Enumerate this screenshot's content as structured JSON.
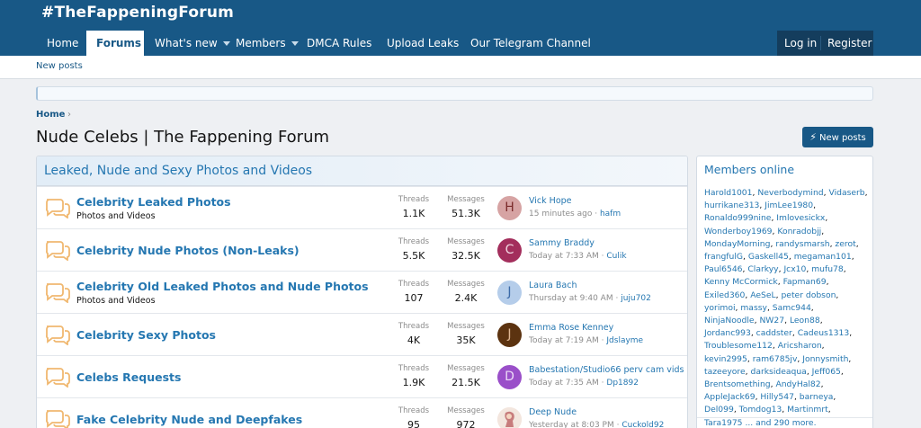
{
  "site": {
    "logo": "#TheFappeningForum"
  },
  "nav": {
    "tabs": [
      {
        "label": "Home"
      },
      {
        "label": "Forums"
      },
      {
        "label": "What's new"
      },
      {
        "label": "Members"
      },
      {
        "label": "DMCA Rules"
      },
      {
        "label": "Upload Leaks"
      },
      {
        "label": "Our Telegram Channel"
      }
    ],
    "login": "Log in",
    "register": "Register"
  },
  "subnav": {
    "new_posts": "New posts"
  },
  "breadcrumb": {
    "home": "Home"
  },
  "page": {
    "title": "Nude Celebs | The Fappening Forum",
    "new_posts_button": "New posts"
  },
  "colors": {
    "header": "#185886",
    "link": "#2577b1",
    "background": "#eef0f3"
  },
  "forum_block": {
    "title": "Leaked, Nude and Sexy Photos and Videos",
    "threads_label": "Threads",
    "messages_label": "Messages",
    "nodes": [
      {
        "title": "Celebrity Leaked Photos",
        "description": "Photos and Videos",
        "threads": "1.1K",
        "messages": "51.3K",
        "avatar_letter": "H",
        "avatar_color": "#d6a3a3",
        "avatar_text_color": "#7a2a2a",
        "last_title": "Vick Hope",
        "last_time": "15 minutes ago",
        "last_user": "hafm"
      },
      {
        "title": "Celebrity Nude Photos (Non-Leaks)",
        "description": "",
        "threads": "5.5K",
        "messages": "32.5K",
        "avatar_letter": "C",
        "avatar_color": "#a32e5c",
        "avatar_text_color": "#f0d6e1",
        "last_title": "Sammy Braddy",
        "last_time": "Today at 7:33 AM",
        "last_user": "Culik"
      },
      {
        "title": "Celebrity Old Leaked Photos and Nude Photos",
        "description": "Photos and Videos",
        "threads": "107",
        "messages": "2.4K",
        "avatar_letter": "J",
        "avatar_color": "#b5cdea",
        "avatar_text_color": "#3b6aa8",
        "last_title": "Laura Bach",
        "last_time": "Thursday at 9:40 AM",
        "last_user": "juju702"
      },
      {
        "title": "Celebrity Sexy Photos",
        "description": "",
        "threads": "4K",
        "messages": "35K",
        "avatar_letter": "J",
        "avatar_color": "#5c3310",
        "avatar_text_color": "#e0b894",
        "last_title": "Emma Rose Kenney",
        "last_time": "Today at 7:19 AM",
        "last_user": "Jdslayme"
      },
      {
        "title": "Celebs Requests",
        "description": "",
        "threads": "1.9K",
        "messages": "21.5K",
        "avatar_letter": "D",
        "avatar_color": "#9a4fc9",
        "avatar_text_color": "#ecdaf7",
        "last_title": "Babestation/Studio66 perv cam vids",
        "last_time": "Today at 7:35 AM",
        "last_user": "Dp1892"
      },
      {
        "title": "Fake Celebrity Nude and Deepfakes",
        "description": "",
        "threads": "95",
        "messages": "972",
        "avatar_letter": "",
        "avatar_color": "#f1e4dc",
        "avatar_text_color": "#b05050",
        "last_title": "Deep Nude",
        "last_time": "Yesterday at 8:03 PM",
        "last_user": "Cuckold92"
      }
    ]
  },
  "members_online": {
    "title": "Members online",
    "members": [
      "Harold1001",
      "Neverbodymind",
      "Vidaserb",
      "hurrikane313",
      "JimLee1980",
      "Ronaldo999nine",
      "Imlovesickx",
      "Wonderboy1969",
      "Konradobjj",
      "MondayMorning",
      "randysmarsh",
      "zerot",
      "frangfulG",
      "Gaskell45",
      "megaman101",
      "Paul6546",
      "Clarkyy",
      "Jcx10",
      "mufu78",
      "Kenny McCormick",
      "Fapman69",
      "Exiled360",
      "AeSeL",
      "peter dobson",
      "yorimoi",
      "massy",
      "Samc944",
      "NinjaNoodle",
      "NW27",
      "Leon88",
      "Jordanc993",
      "caddster",
      "Cadeus1313",
      "Troublesome112",
      "Aricsharon",
      "kevin2995",
      "ram6785jv",
      "Jonnysmith",
      "tazeeyore",
      "darksideaqua",
      "Jeff065",
      "Brentsomething",
      "AndyHal82",
      "AppleJack69",
      "Hilly547",
      "barneya",
      "Del099",
      "Tomdog13",
      "Martinmrt",
      "Tara1975"
    ],
    "more": "... and 290 more."
  }
}
